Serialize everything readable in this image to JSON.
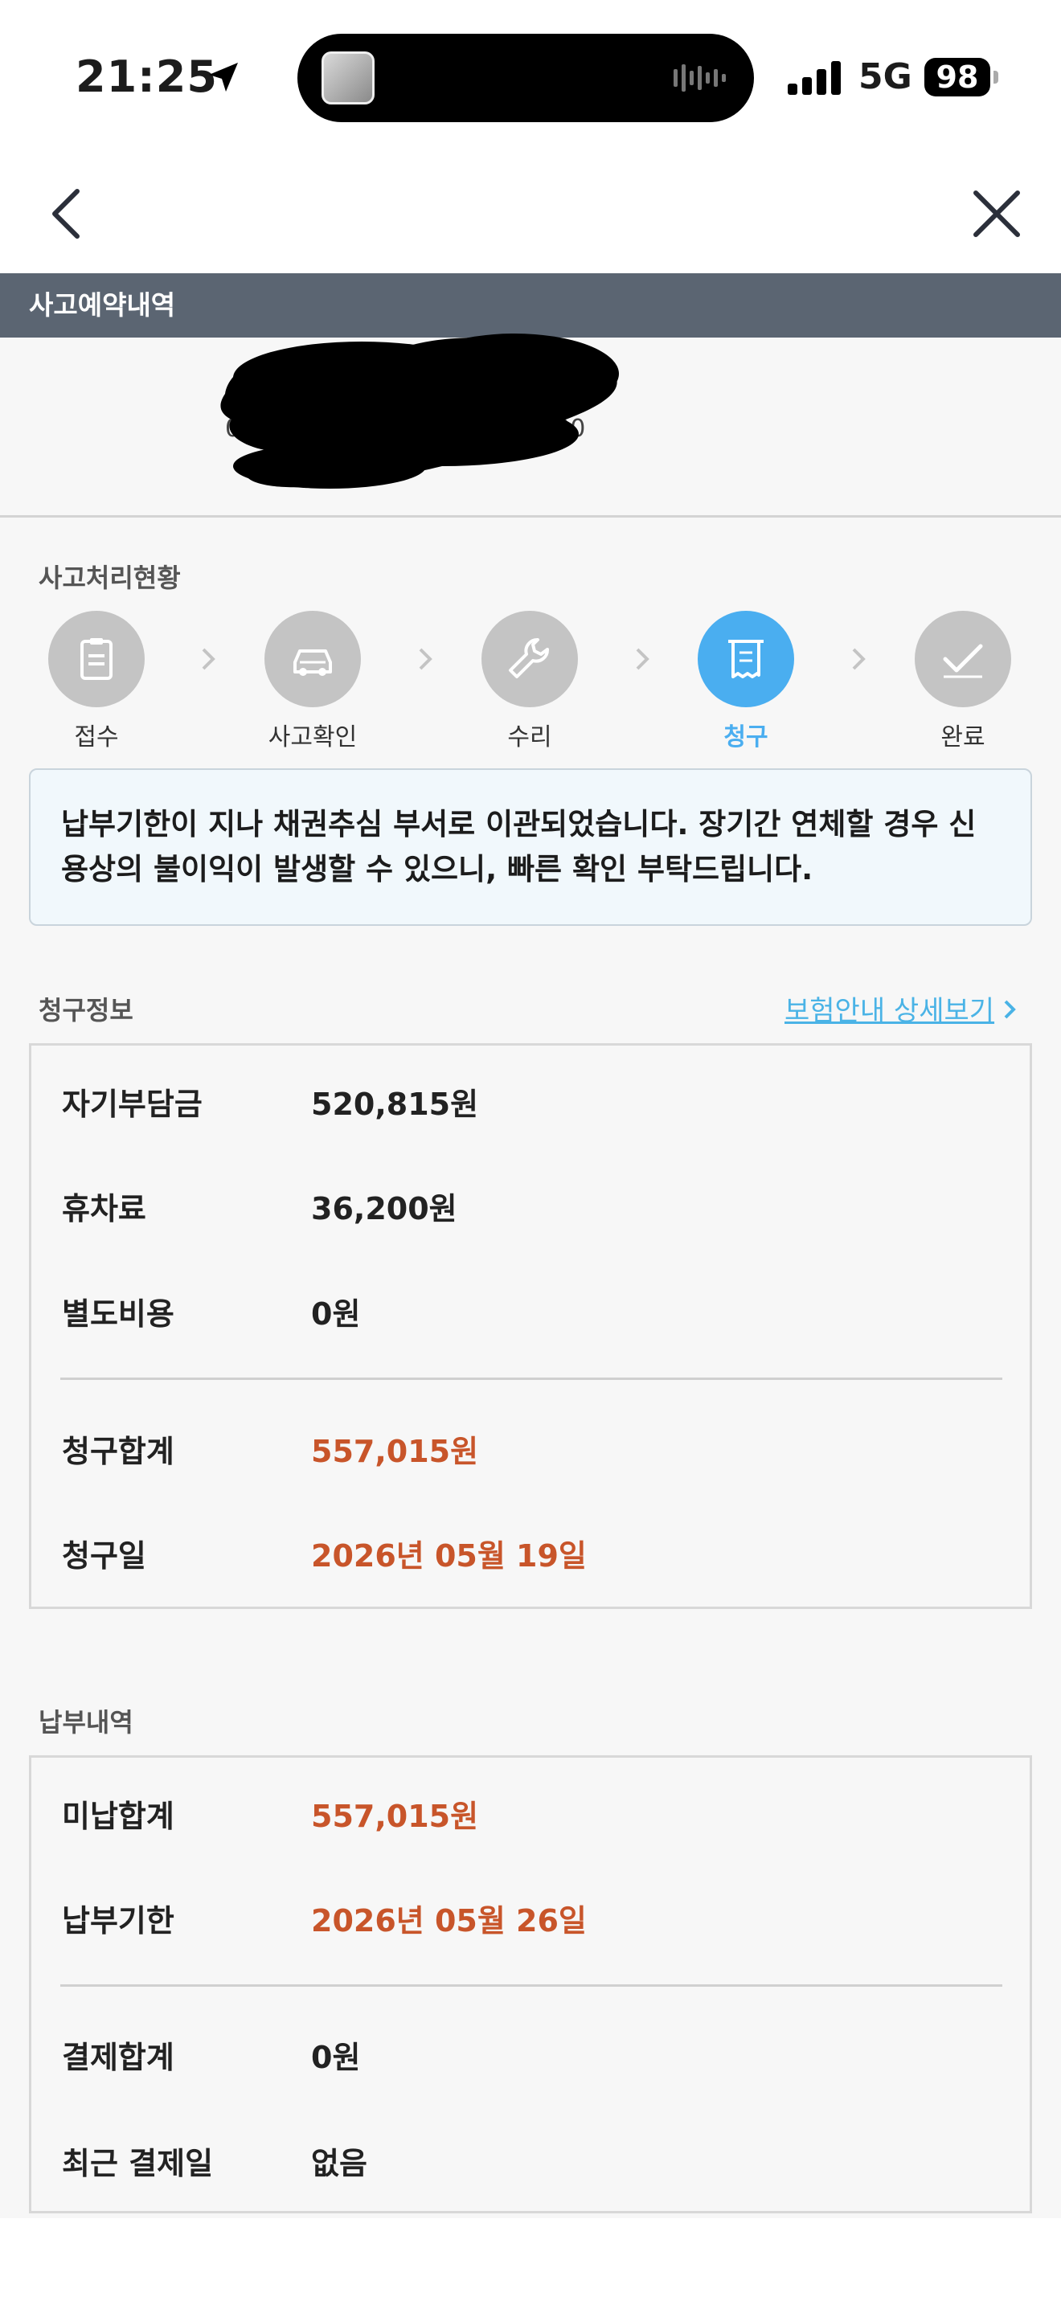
{
  "status_bar": {
    "time": "21:25",
    "network": "5G",
    "battery": "98"
  },
  "nav": {
    "back_icon": "chevron-left-icon",
    "close_icon": "close-icon"
  },
  "section_title": "사고예약내역",
  "redacted_peek": {
    "left": "05",
    "right": ":20"
  },
  "progress": {
    "title": "사고처리현황",
    "steps": [
      {
        "label": "접수",
        "icon": "clipboard-icon",
        "active": false
      },
      {
        "label": "사고확인",
        "icon": "car-icon",
        "active": false
      },
      {
        "label": "수리",
        "icon": "wrench-icon",
        "active": false
      },
      {
        "label": "청구",
        "icon": "receipt-icon",
        "active": true
      },
      {
        "label": "완료",
        "icon": "check-icon",
        "active": false
      }
    ]
  },
  "notice": "납부기한이 지나 채권추심 부서로 이관되었습니다. 장기간 연체할 경우 신용상의 불이익이 발생할 수 있으니, 빠른 확인 부탁드립니다.",
  "billing": {
    "title": "청구정보",
    "detail_link": "보험안내 상세보기",
    "rows": [
      {
        "label": "자기부담금",
        "value": "520,815원"
      },
      {
        "label": "휴차료",
        "value": "36,200원"
      },
      {
        "label": "별도비용",
        "value": "0원"
      },
      {
        "label": "청구합계",
        "value": "557,015원"
      },
      {
        "label": "청구일",
        "value": "2026년 05월 19일"
      }
    ]
  },
  "payment": {
    "title": "납부내역",
    "rows": [
      {
        "label": "미납합계",
        "value": "557,015원"
      },
      {
        "label": "납부기한",
        "value": "2026년 05월 26일"
      },
      {
        "label": "결제합계",
        "value": "0원"
      },
      {
        "label": "최근 결제일",
        "value": "없음"
      }
    ]
  },
  "colors": {
    "accent_orange": "#c8552a",
    "active_blue": "#4aaef0",
    "header_bar": "#5b6572"
  }
}
